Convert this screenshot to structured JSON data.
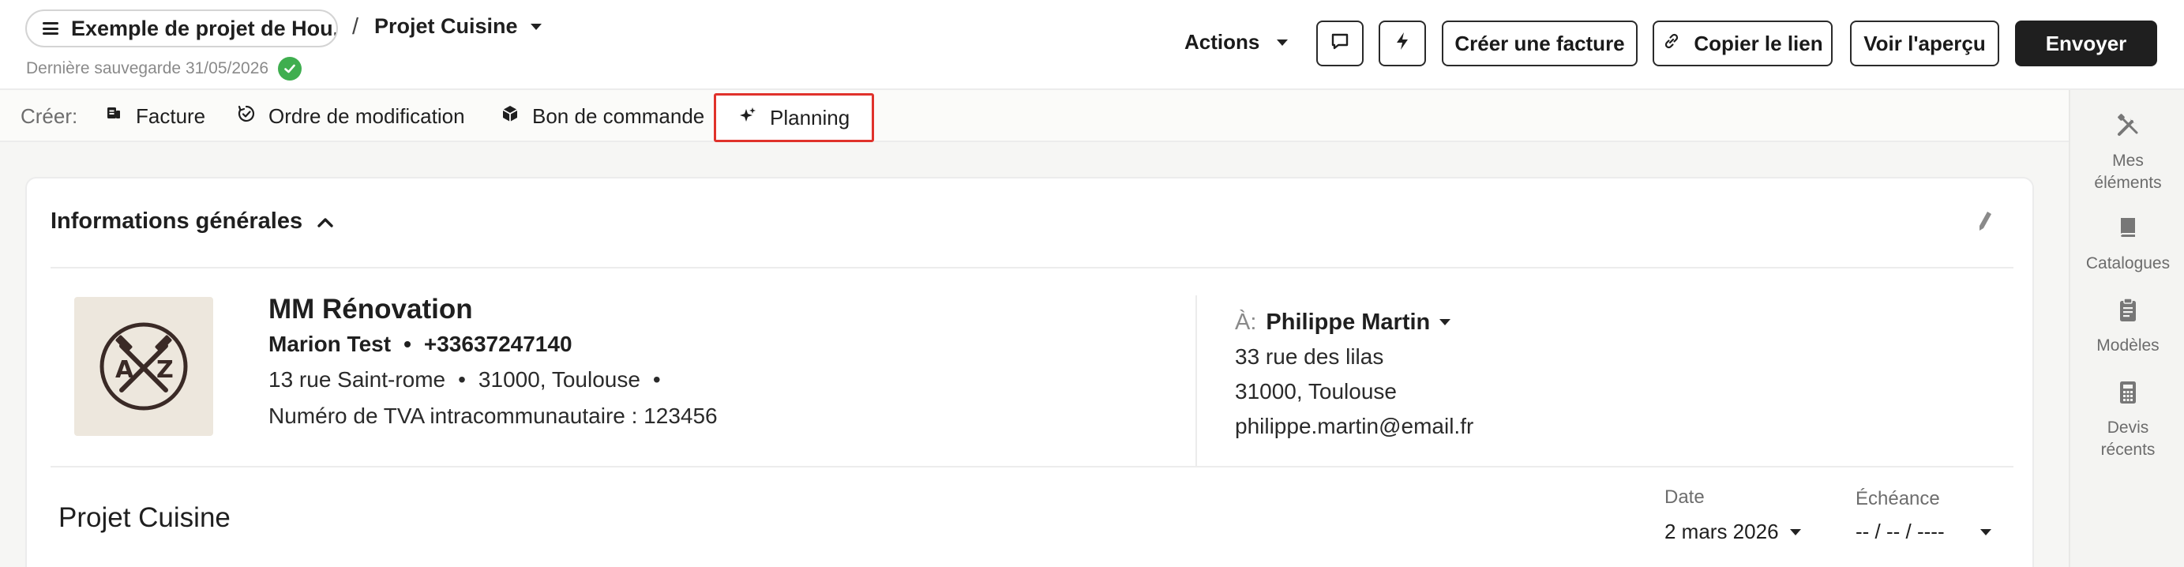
{
  "header": {
    "project_name": "Exemple de projet de Hou...",
    "breadcrumb_separator": "/",
    "current_page": "Projet Cuisine",
    "last_saved": "Dernière sauvegarde 31/05/2026",
    "actions_label": "Actions",
    "create_invoice_label": "Créer une facture",
    "copy_link_label": "Copier le lien",
    "preview_label": "Voir l'aperçu",
    "send_label": "Envoyer"
  },
  "create_bar": {
    "label": "Créer:",
    "items": [
      {
        "label": "Facture",
        "icon": "invoice-icon"
      },
      {
        "label": "Ordre de modification",
        "icon": "change-order-icon"
      },
      {
        "label": "Bon de commande",
        "icon": "box-icon"
      },
      {
        "label": "Planning",
        "icon": "sparkle-icon"
      }
    ]
  },
  "rail": {
    "items": [
      {
        "label_1": "Mes",
        "label_2": "éléments",
        "icon": "tools-icon"
      },
      {
        "label_1": "Catalogues",
        "icon": "book-icon"
      },
      {
        "label_1": "Modèles",
        "icon": "clipboard-icon"
      },
      {
        "label_1": "Devis",
        "label_2": "récents",
        "icon": "calculator-icon"
      }
    ]
  },
  "general_info": {
    "title": "Informations générales",
    "company": {
      "name": "MM Rénovation",
      "contact_name": "Marion Test",
      "phone": "+33637247140",
      "street": "13 rue Saint-rome",
      "city": "31000, Toulouse",
      "vat": "Numéro de TVA intracommunautaire : 123456"
    },
    "client": {
      "to_prefix": "À:",
      "name": "Philippe Martin",
      "street": "33 rue des lilas",
      "city": "31000, Toulouse",
      "email": "philippe.martin@email.fr"
    }
  },
  "project": {
    "title": "Projet Cuisine",
    "date_label": "Date",
    "date_value": "2 mars 2026",
    "due_label": "Échéance",
    "due_value": "-- / -- / ----"
  },
  "colors": {
    "highlight": "#e0322b",
    "save_ok": "#3fae4f",
    "primary_dark": "#1f1f1f"
  }
}
